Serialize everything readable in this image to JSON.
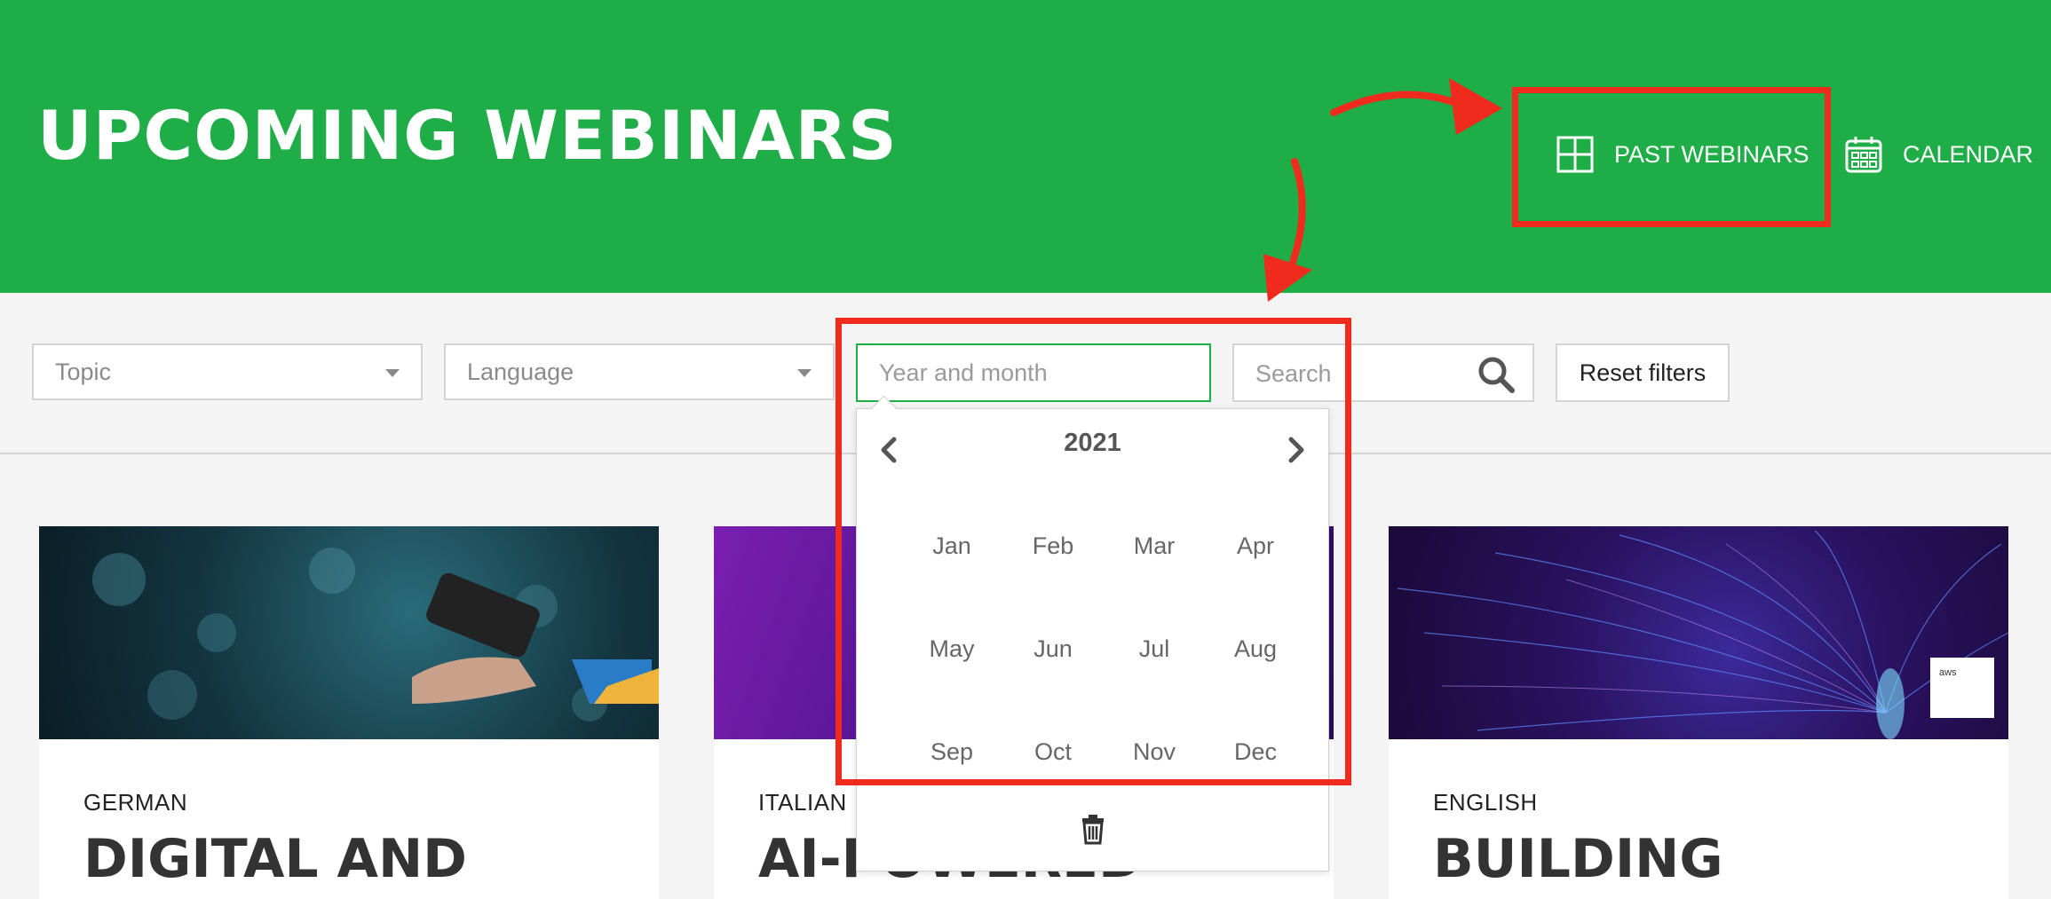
{
  "header": {
    "title": "UPCOMING WEBINARS",
    "past_webinars_label": "PAST WEBINARS",
    "calendar_label": "CALENDAR"
  },
  "filters": {
    "topic_placeholder": "Topic",
    "language_placeholder": "Language",
    "date_placeholder": "Year and month",
    "search_placeholder": "Search",
    "reset_label": "Reset filters"
  },
  "picker": {
    "year": "2021",
    "months": [
      "Jan",
      "Feb",
      "Mar",
      "Apr",
      "May",
      "Jun",
      "Jul",
      "Aug",
      "Sep",
      "Oct",
      "Nov",
      "Dec"
    ]
  },
  "cards": [
    {
      "language": "GERMAN",
      "title": "DIGITAL AND"
    },
    {
      "language": "ITALIAN",
      "title": "AI-POWERED"
    },
    {
      "language": "ENGLISH",
      "title": "BUILDING"
    }
  ],
  "colors": {
    "brand_green": "#1fad48",
    "annotation_red": "#f02a1d"
  },
  "icons": [
    "grid-icon",
    "calendar-icon",
    "search-icon",
    "chevron-left-icon",
    "chevron-right-icon",
    "trash-icon",
    "chevron-down-icon"
  ]
}
